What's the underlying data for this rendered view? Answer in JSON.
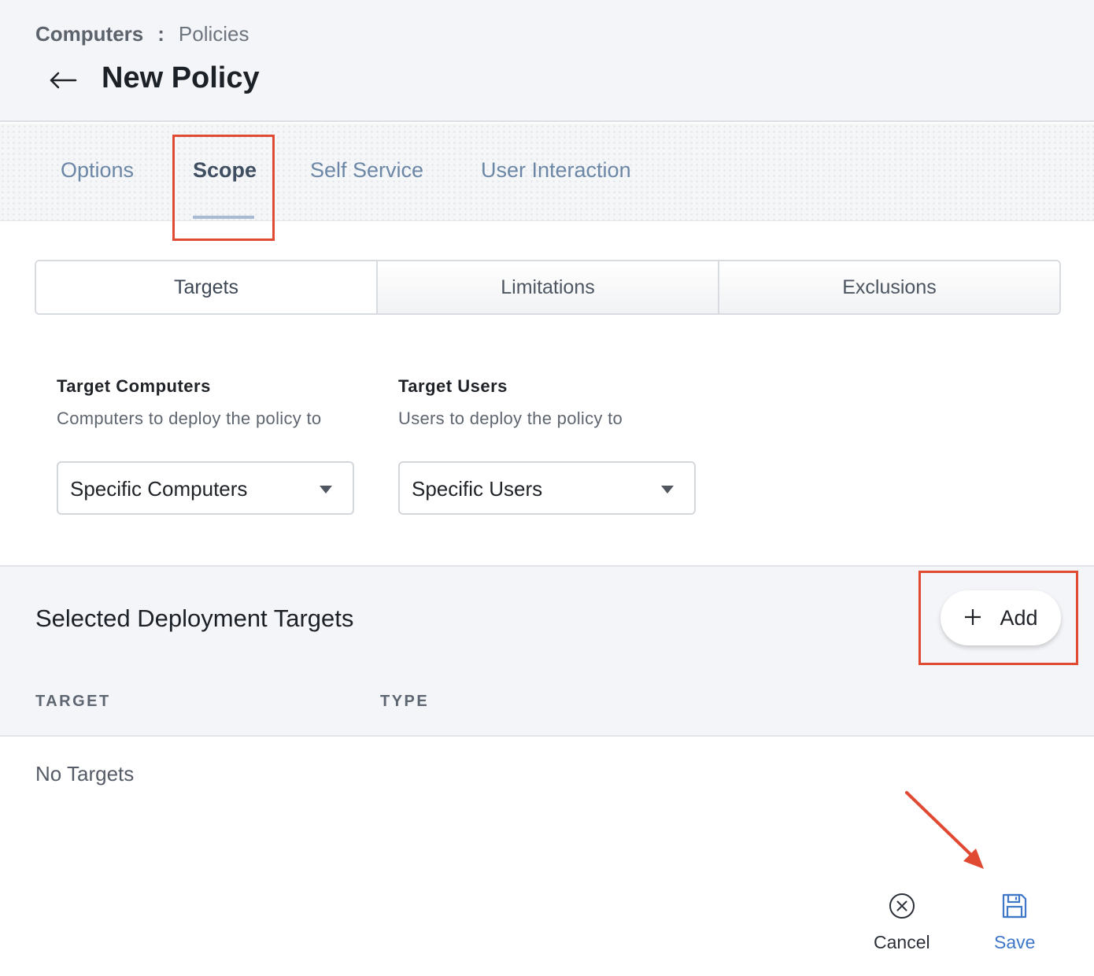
{
  "breadcrumb": {
    "root": "Computers",
    "separator": ":",
    "current": "Policies"
  },
  "page": {
    "title": "New Policy"
  },
  "tabs": [
    {
      "label": "Options",
      "active": false
    },
    {
      "label": "Scope",
      "active": true
    },
    {
      "label": "Self Service",
      "active": false
    },
    {
      "label": "User Interaction",
      "active": false
    }
  ],
  "scope_tabs": [
    {
      "label": "Targets",
      "active": true
    },
    {
      "label": "Limitations",
      "active": false
    },
    {
      "label": "Exclusions",
      "active": false
    }
  ],
  "target_computers": {
    "title": "Target Computers",
    "description": "Computers to deploy the policy to",
    "selected": "Specific Computers"
  },
  "target_users": {
    "title": "Target Users",
    "description": "Users to deploy the policy to",
    "selected": "Specific Users"
  },
  "deployment_targets": {
    "title": "Selected Deployment Targets",
    "add_label": "Add",
    "columns": [
      "TARGET",
      "TYPE"
    ],
    "empty_text": "No Targets"
  },
  "actions": {
    "cancel_label": "Cancel",
    "save_label": "Save"
  },
  "colors": {
    "tab_inactive": "#6c87a6",
    "tab_active": "#3f4f61",
    "save_accent": "#3f77c8",
    "annotation_red": "#e04a33"
  },
  "icons": [
    "back-arrow-icon",
    "dropdown-caret-icon",
    "plus-icon",
    "cancel-circle-icon",
    "save-floppy-icon"
  ]
}
